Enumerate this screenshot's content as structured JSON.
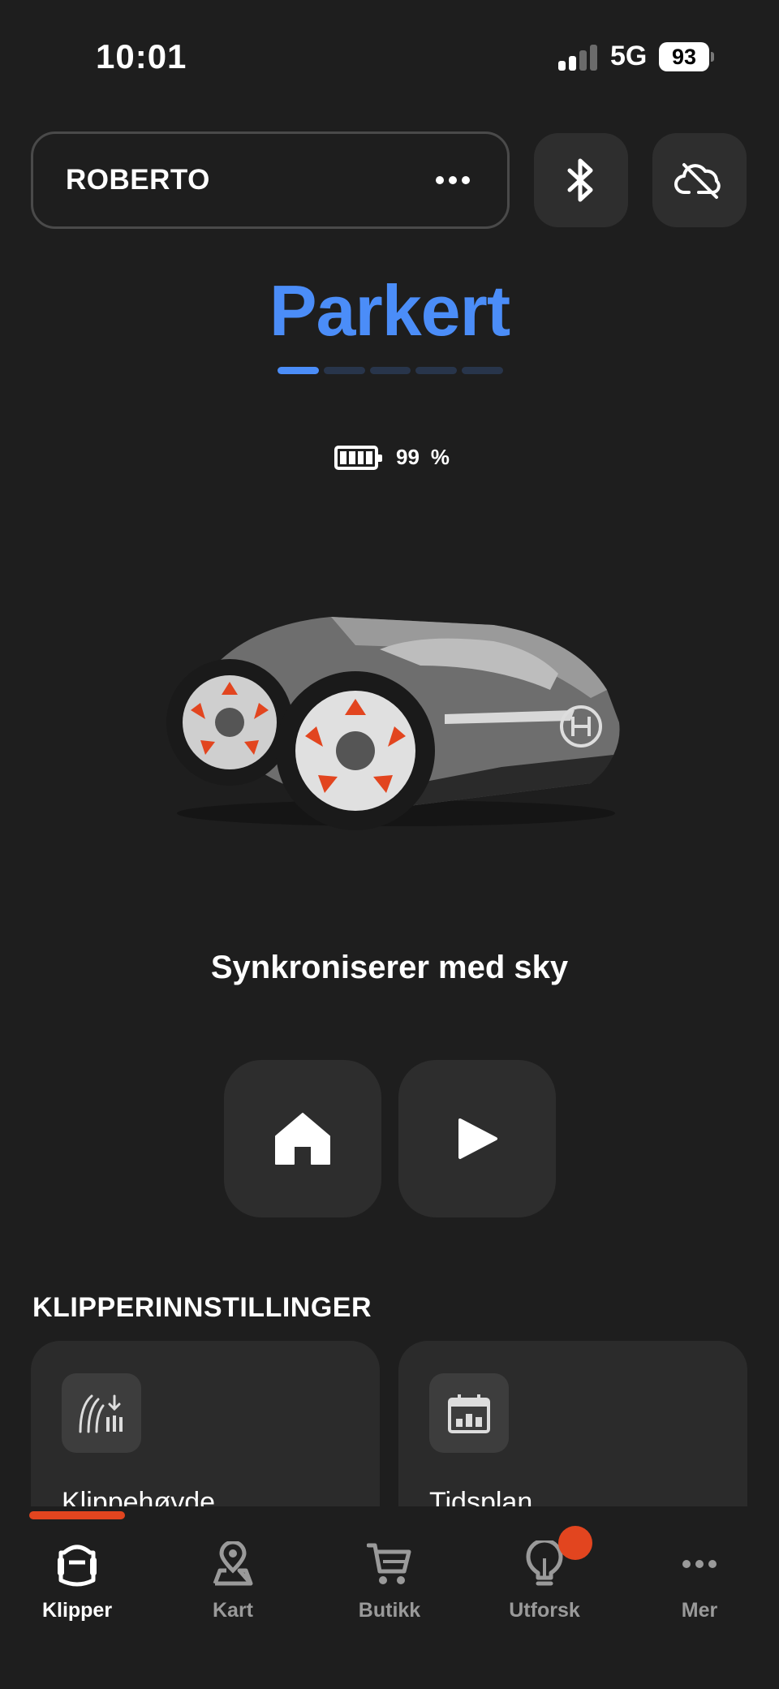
{
  "status_bar": {
    "time": "10:01",
    "network": "5G",
    "battery": "93"
  },
  "header": {
    "mower_name": "ROBERTO"
  },
  "mower": {
    "state": "Parkert",
    "progress_step": 1,
    "progress_total": 5,
    "battery_value": "99",
    "battery_unit": "%",
    "sync_text": "Synkroniserer med sky"
  },
  "settings": {
    "title": "KLIPPERINNSTILLINGER",
    "cards": [
      {
        "label": "Klippehøyde",
        "icon": "cutting-height-icon"
      },
      {
        "label": "Tidsplan",
        "icon": "calendar-icon"
      }
    ]
  },
  "tabs": [
    {
      "label": "Klipper",
      "icon": "mower-icon",
      "active": true
    },
    {
      "label": "Kart",
      "icon": "map-pin-icon",
      "active": false
    },
    {
      "label": "Butikk",
      "icon": "cart-icon",
      "active": false
    },
    {
      "label": "Utforsk",
      "icon": "lightbulb-icon",
      "active": false,
      "badge": true
    },
    {
      "label": "Mer",
      "icon": "more-icon",
      "active": false
    }
  ],
  "colors": {
    "accent": "#4b8df8",
    "brand": "#e2451f",
    "background": "#1e1e1e"
  }
}
